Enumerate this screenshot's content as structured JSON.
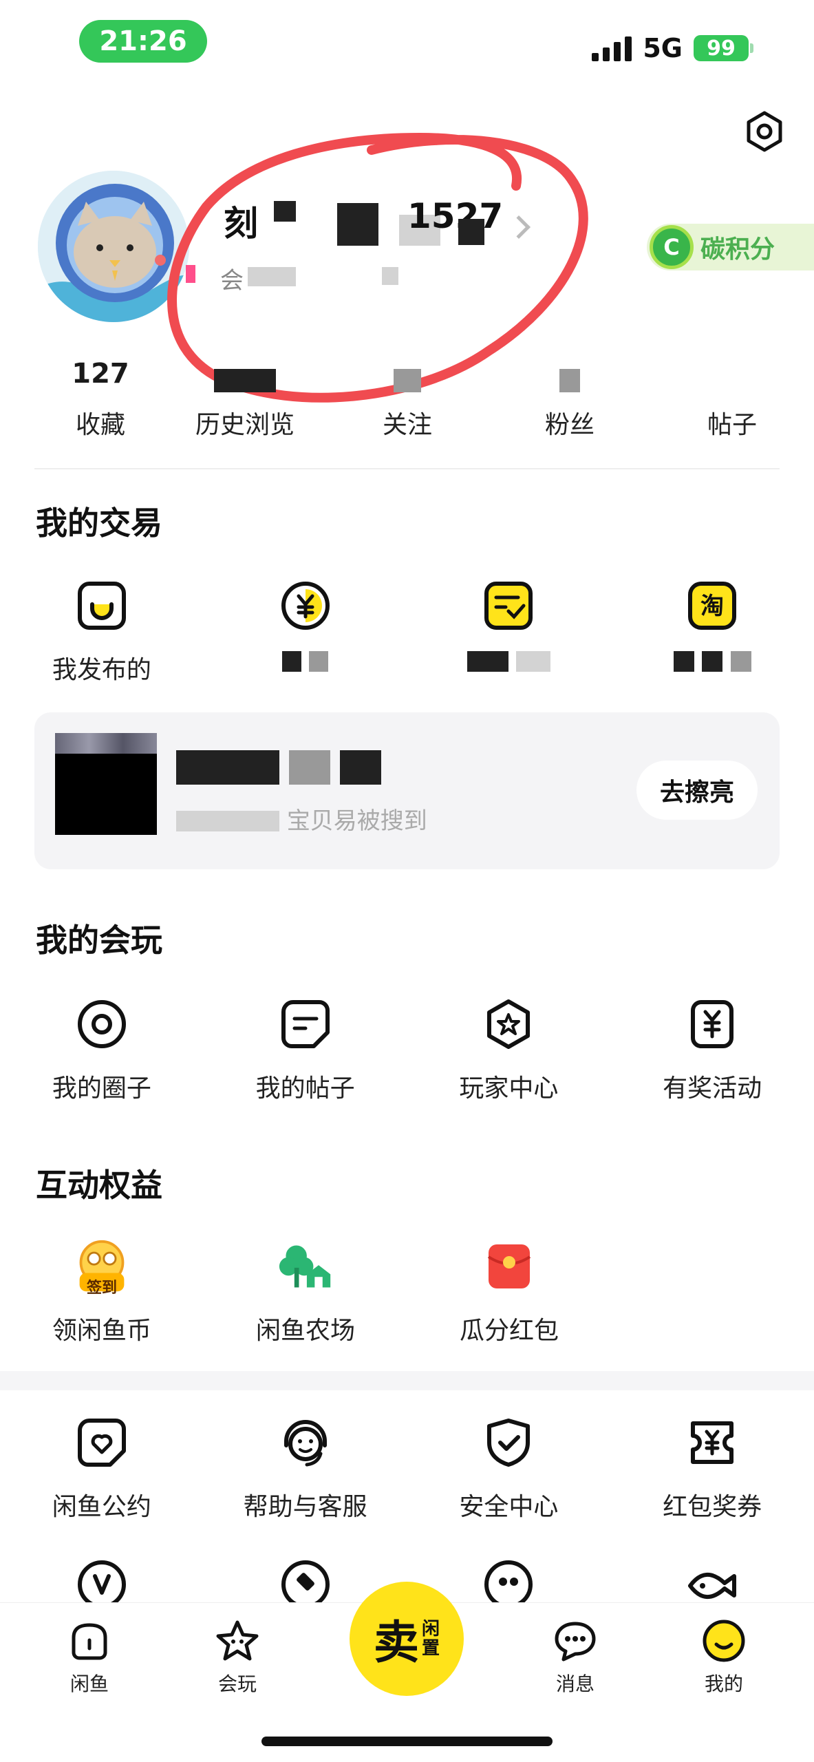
{
  "status_bar": {
    "time": "21:26",
    "network": "5G",
    "battery": "99"
  },
  "profile": {
    "name_visible": "刻",
    "name_suffix": "1527",
    "sub_visible": "会",
    "carbon_badge": "C",
    "carbon_label": "碳积分"
  },
  "stats": [
    {
      "num": "127",
      "label": "收藏"
    },
    {
      "num": "",
      "label": "历史浏览"
    },
    {
      "num": "",
      "label": "关注"
    },
    {
      "num": "",
      "label": "粉丝"
    },
    {
      "num": "",
      "label": "帖子"
    }
  ],
  "trade": {
    "title": "我的交易",
    "items": [
      {
        "label": "我发布的",
        "icon": "box-icon"
      },
      {
        "label": "",
        "icon": "yen-icon"
      },
      {
        "label": "",
        "icon": "order-check-icon"
      },
      {
        "label": "",
        "icon": "taobao-icon",
        "glyph": "淘"
      }
    ]
  },
  "promo": {
    "title": "",
    "subtitle": "宝贝易被搜到",
    "button": "去擦亮"
  },
  "play": {
    "title": "我的会玩",
    "items": [
      {
        "label": "我的圈子",
        "icon": "circle-target-icon"
      },
      {
        "label": "我的帖子",
        "icon": "post-icon"
      },
      {
        "label": "玩家中心",
        "icon": "star-badge-icon"
      },
      {
        "label": "有奖活动",
        "icon": "yen-ticket-icon"
      }
    ]
  },
  "benefits": {
    "title": "互动权益",
    "items": [
      {
        "label": "领闲鱼币",
        "icon": "checkin-icon",
        "badge": "签到"
      },
      {
        "label": "闲鱼农场",
        "icon": "farm-icon"
      },
      {
        "label": "瓜分红包",
        "icon": "red-envelope-icon"
      }
    ]
  },
  "services": [
    {
      "label": "闲鱼公约",
      "icon": "heart-doc-icon"
    },
    {
      "label": "帮助与客服",
      "icon": "headset-smile-icon"
    },
    {
      "label": "安全中心",
      "icon": "shield-check-icon"
    },
    {
      "label": "红包奖券",
      "icon": "coupon-icon"
    }
  ],
  "bottom_nav": {
    "items": [
      {
        "label": "闲鱼",
        "icon": "home-icon"
      },
      {
        "label": "会玩",
        "icon": "star-face-icon"
      },
      {
        "label": "消息",
        "icon": "chat-icon"
      },
      {
        "label": "我的",
        "icon": "smile-icon"
      }
    ],
    "sell_main": "卖",
    "sell_sub_1": "闲",
    "sell_sub_2": "置"
  },
  "colors": {
    "accent_yellow": "#ffe31a",
    "status_green": "#34c759",
    "annotation_red": "#f04b50"
  }
}
